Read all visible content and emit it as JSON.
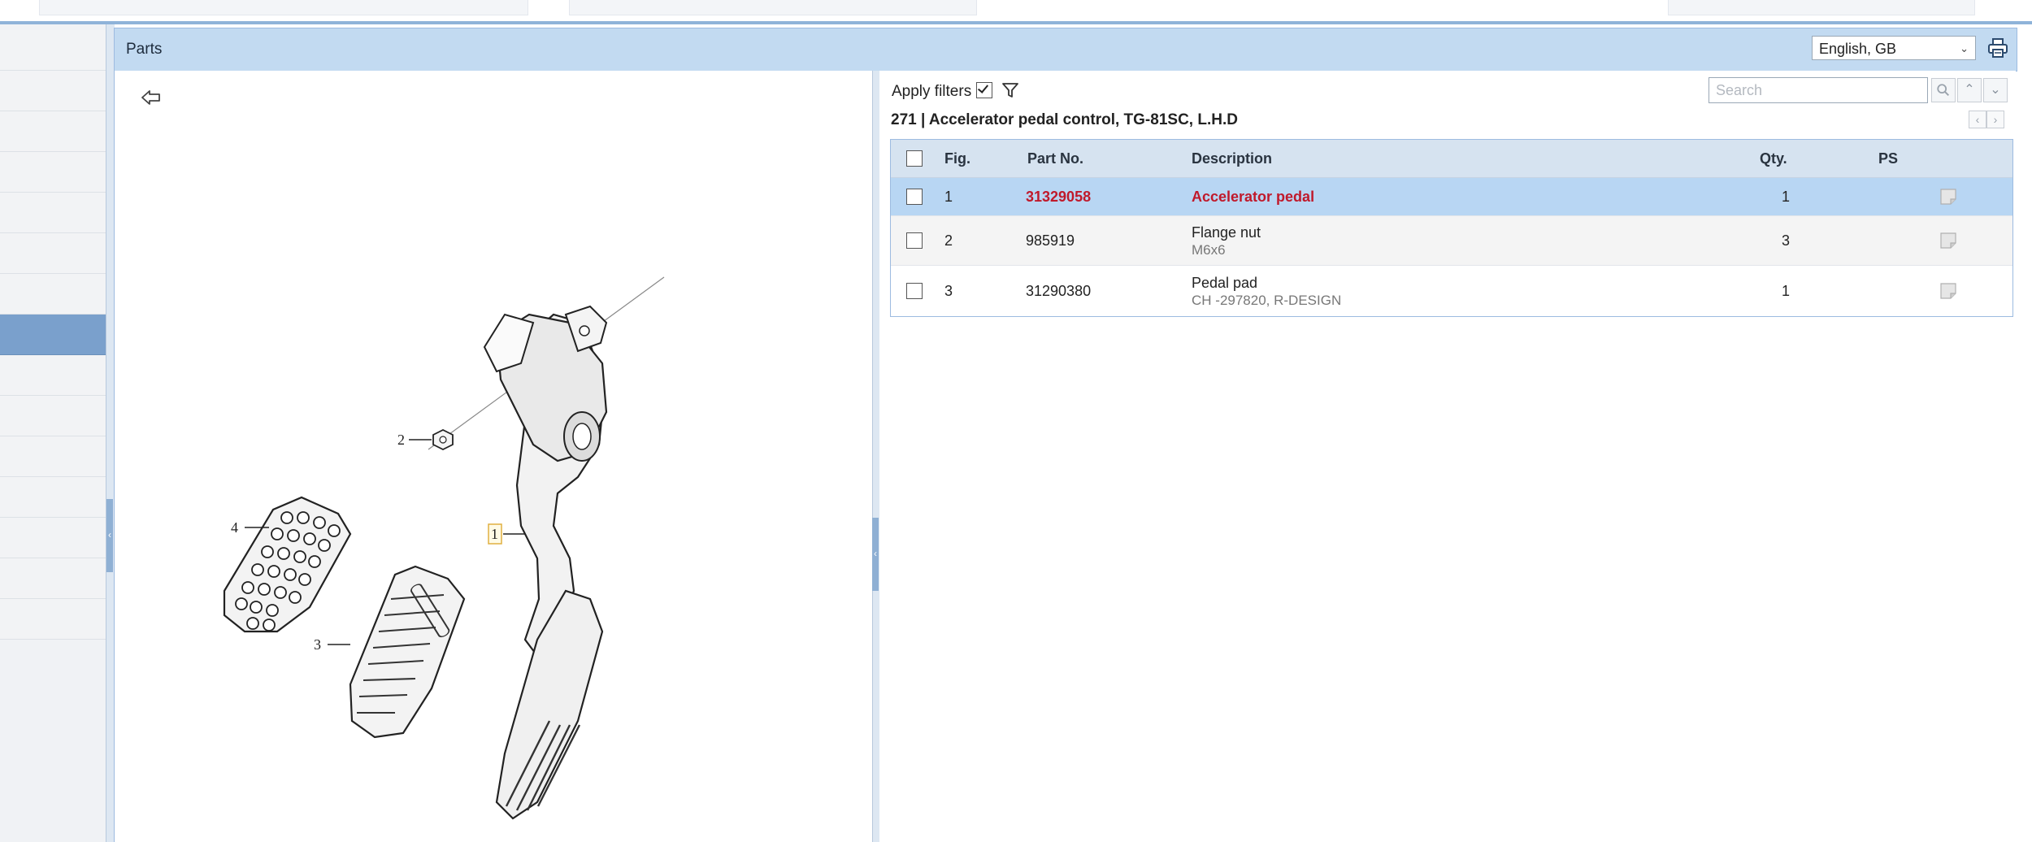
{
  "header": {
    "title": "Parts",
    "language": "English, GB"
  },
  "drawing": {
    "callouts": [
      "1",
      "2",
      "3",
      "4"
    ]
  },
  "filters": {
    "label": "Apply filters",
    "checked": true
  },
  "search": {
    "placeholder": "Search"
  },
  "group": {
    "heading": "271  |  Accelerator pedal control, TG-81SC, L.H.D"
  },
  "table": {
    "columns": [
      "Fig.",
      "Part No.",
      "Description",
      "Qty.",
      "PS"
    ],
    "rows": [
      {
        "fig": "1",
        "part_no": "31329058",
        "description": "Accelerator pedal",
        "note": "",
        "qty": "1"
      },
      {
        "fig": "2",
        "part_no": "985919",
        "description": "Flange nut",
        "note": "M6x6",
        "qty": "3"
      },
      {
        "fig": "3",
        "part_no": "31290380",
        "description": "Pedal pad",
        "note": "CH -297820, R-DESIGN",
        "qty": "1"
      }
    ]
  },
  "colors": {
    "header_bg": "#c2daf1",
    "selected_row": "#b8d6f3",
    "part_highlight": "#c0192b",
    "sidebar_active": "#7aa0cc"
  }
}
